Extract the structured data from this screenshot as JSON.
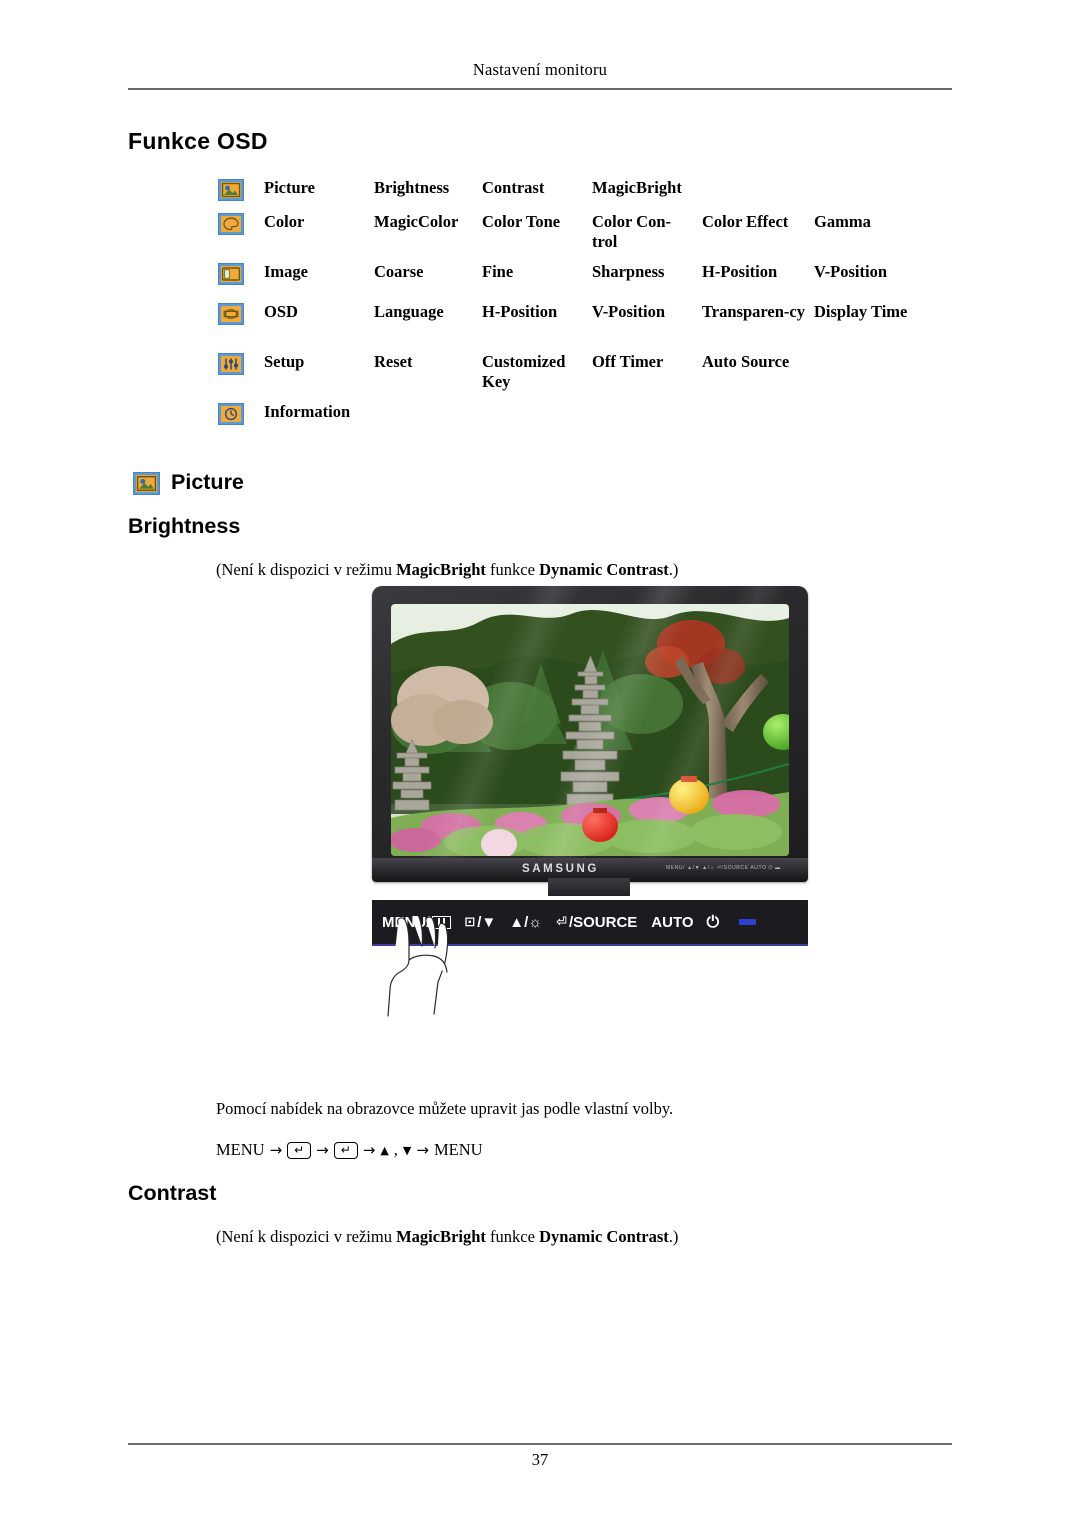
{
  "header": {
    "running_title": "Nastavení monitoru"
  },
  "footer": {
    "page_number": "37"
  },
  "sections": {
    "osd_functions_heading": "Funkce OSD",
    "picture_heading": "Picture",
    "brightness_heading": "Brightness",
    "contrast_heading": "Contrast"
  },
  "osd_table": {
    "rows": [
      {
        "icon": "picture-icon",
        "name": "Picture",
        "items": [
          "Brightness",
          "Contrast",
          "MagicBright",
          "",
          ""
        ]
      },
      {
        "icon": "color-icon",
        "name": "Color",
        "items": [
          "MagicColor",
          "Color Tone",
          "Color Con-trol",
          "Color Effect",
          "Gamma"
        ]
      },
      {
        "icon": "image-icon",
        "name": "Image",
        "items": [
          "Coarse",
          "Fine",
          "Sharpness",
          "H-Position",
          "V-Position"
        ]
      },
      {
        "icon": "osd-icon",
        "name": "OSD",
        "items": [
          "Language",
          "H-Position",
          "V-Position",
          "Transparen-cy",
          "Display Time"
        ]
      },
      {
        "icon": "setup-icon",
        "name": "Setup",
        "items": [
          "Reset",
          "Customized Key",
          "Off Timer",
          "Auto Source",
          ""
        ]
      },
      {
        "icon": "information-icon",
        "name": "Information",
        "items": [
          "",
          "",
          "",
          "",
          ""
        ]
      }
    ]
  },
  "brightness": {
    "note_prefix": "(Není k dispozici v režimu ",
    "note_bold_1": "MagicBright",
    "note_middle": " funkce ",
    "note_bold_2": "Dynamic Contrast",
    "note_suffix": ".)",
    "description": "Pomocí nabídek na obrazovce můžete upravit jas podle vlastní volby.",
    "menu_path": {
      "start": "MENU",
      "arrow": "→",
      "key_glyph": "↵",
      "up_glyph": "▲",
      "comma": ",",
      "down_glyph": "▼",
      "end": "MENU"
    }
  },
  "contrast": {
    "note_prefix": "(Není k dispozici v režimu ",
    "note_bold_1": "MagicBright",
    "note_middle": " funkce ",
    "note_bold_2": "Dynamic Contrast",
    "note_suffix": ".)"
  },
  "monitor": {
    "brand": "SAMSUNG",
    "bezel_button_labels": "MENU/ ▲/▼  ▲/☼  ⏎/SOURCE  AUTO  ⏻  ▬",
    "controls": [
      {
        "label": "MENU/",
        "glyph": "menu-grid-icon"
      },
      {
        "label": "/▼",
        "glyph": "input-source-icon"
      },
      {
        "label": "▲/☼",
        "glyph": "brightness-icon"
      },
      {
        "label": "/SOURCE",
        "glyph": "enter-source-icon"
      },
      {
        "label": "AUTO",
        "glyph": ""
      },
      {
        "label": "⏻",
        "glyph": "power-icon"
      }
    ],
    "control_labels": {
      "menu": "MENU/",
      "down": "/▼",
      "up_bright": "▲/☼",
      "source": "/SOURCE",
      "auto": "AUTO",
      "power": "⏻"
    }
  },
  "colors": {
    "icon_orange": "#f2a93b",
    "icon_blue_border": "#5b9bd5",
    "rule_gray": "#6b6b6b",
    "led_blue": "#2f3fd0"
  }
}
